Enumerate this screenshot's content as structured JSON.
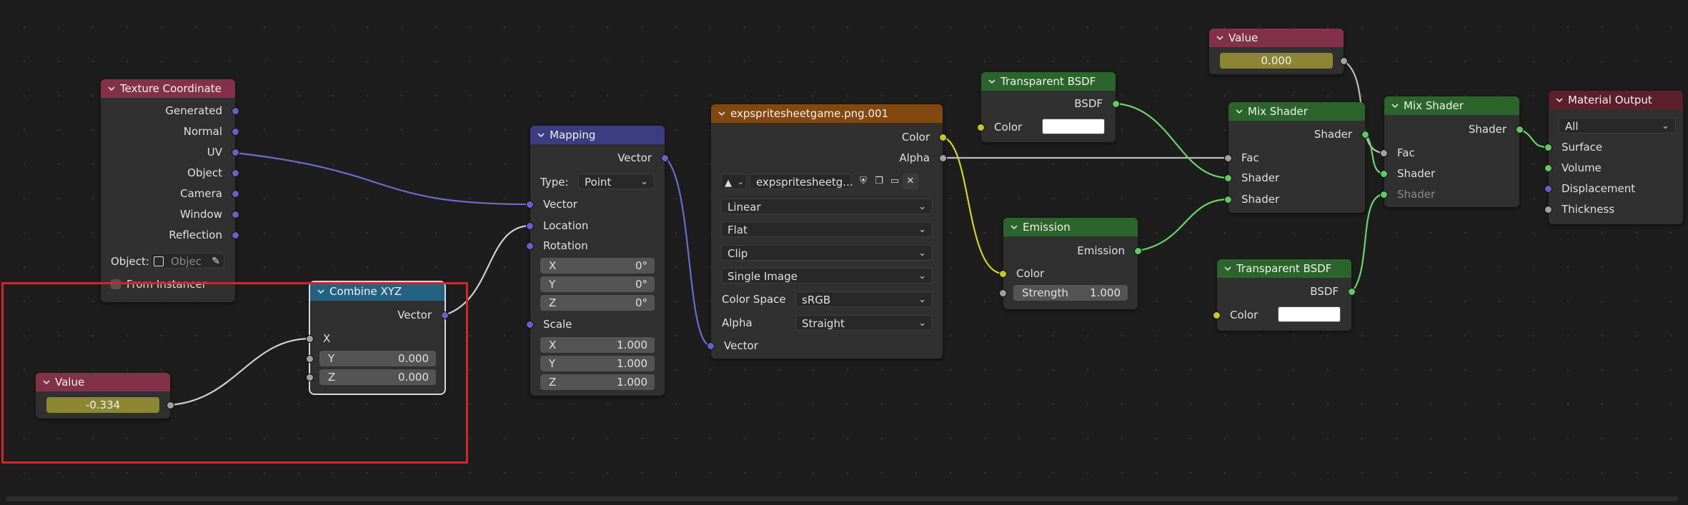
{
  "nodes": {
    "texture_coordinate": {
      "title": "Texture Coordinate",
      "outputs": [
        "Generated",
        "Normal",
        "UV",
        "Object",
        "Camera",
        "Window",
        "Reflection"
      ],
      "object_label": "Object:",
      "object_placeholder": "Objec",
      "from_instancer": "From Instancer"
    },
    "value_left": {
      "title": "Value",
      "value": "-0.334"
    },
    "combine_xyz": {
      "title": "Combine XYZ",
      "output": "Vector",
      "x_label": "X",
      "y_label": "Y",
      "y_value": "0.000",
      "z_label": "Z",
      "z_value": "0.000"
    },
    "mapping": {
      "title": "Mapping",
      "output": "Vector",
      "type_label": "Type:",
      "type_value": "Point",
      "vector_in": "Vector",
      "location": "Location",
      "rotation": "Rotation",
      "rot_x_label": "X",
      "rot_x": "0°",
      "rot_y_label": "Y",
      "rot_y": "0°",
      "rot_z_label": "Z",
      "rot_z": "0°",
      "scale": "Scale",
      "scale_x_label": "X",
      "scale_x": "1.000",
      "scale_y_label": "Y",
      "scale_y": "1.000",
      "scale_z_label": "Z",
      "scale_z": "1.000"
    },
    "image_texture": {
      "title": "expspritesheetgame.png.001",
      "out_color": "Color",
      "out_alpha": "Alpha",
      "image_name": "expspritesheetg...",
      "interpolation": "Linear",
      "projection": "Flat",
      "extension": "Clip",
      "source": "Single Image",
      "color_space_label": "Color Space",
      "color_space": "sRGB",
      "alpha_label": "Alpha",
      "alpha": "Straight",
      "vector_in": "Vector"
    },
    "transparent_bsdf_top": {
      "title": "Transparent BSDF",
      "output": "BSDF",
      "color_label": "Color"
    },
    "emission": {
      "title": "Emission",
      "output": "Emission",
      "color_label": "Color",
      "strength_label": "Strength",
      "strength_value": "1.000"
    },
    "value_top": {
      "title": "Value",
      "value": "0.000"
    },
    "mix_shader_1": {
      "title": "Mix Shader",
      "output": "Shader",
      "fac": "Fac",
      "shader_a": "Shader",
      "shader_b": "Shader"
    },
    "transparent_bsdf_bottom": {
      "title": "Transparent BSDF",
      "output": "BSDF",
      "color_label": "Color"
    },
    "mix_shader_2": {
      "title": "Mix Shader",
      "output": "Shader",
      "fac": "Fac",
      "shader_a": "Shader",
      "shader_b": "Shader"
    },
    "material_output": {
      "title": "Material Output",
      "target": "All",
      "inputs": [
        "Surface",
        "Volume",
        "Displacement",
        "Thickness"
      ]
    }
  },
  "colors": {
    "header_input": "#83314a",
    "header_vector": "#3c3c83",
    "header_converter": "#246283",
    "header_texture": "#83480f",
    "header_shader": "#2b652b",
    "header_output": "#5b1f2e",
    "socket_vector": "#6363c7",
    "socket_color": "#c7c729",
    "socket_float": "#a1a1a1",
    "socket_shader": "#63c763",
    "highlight_box": "#d1262a"
  }
}
